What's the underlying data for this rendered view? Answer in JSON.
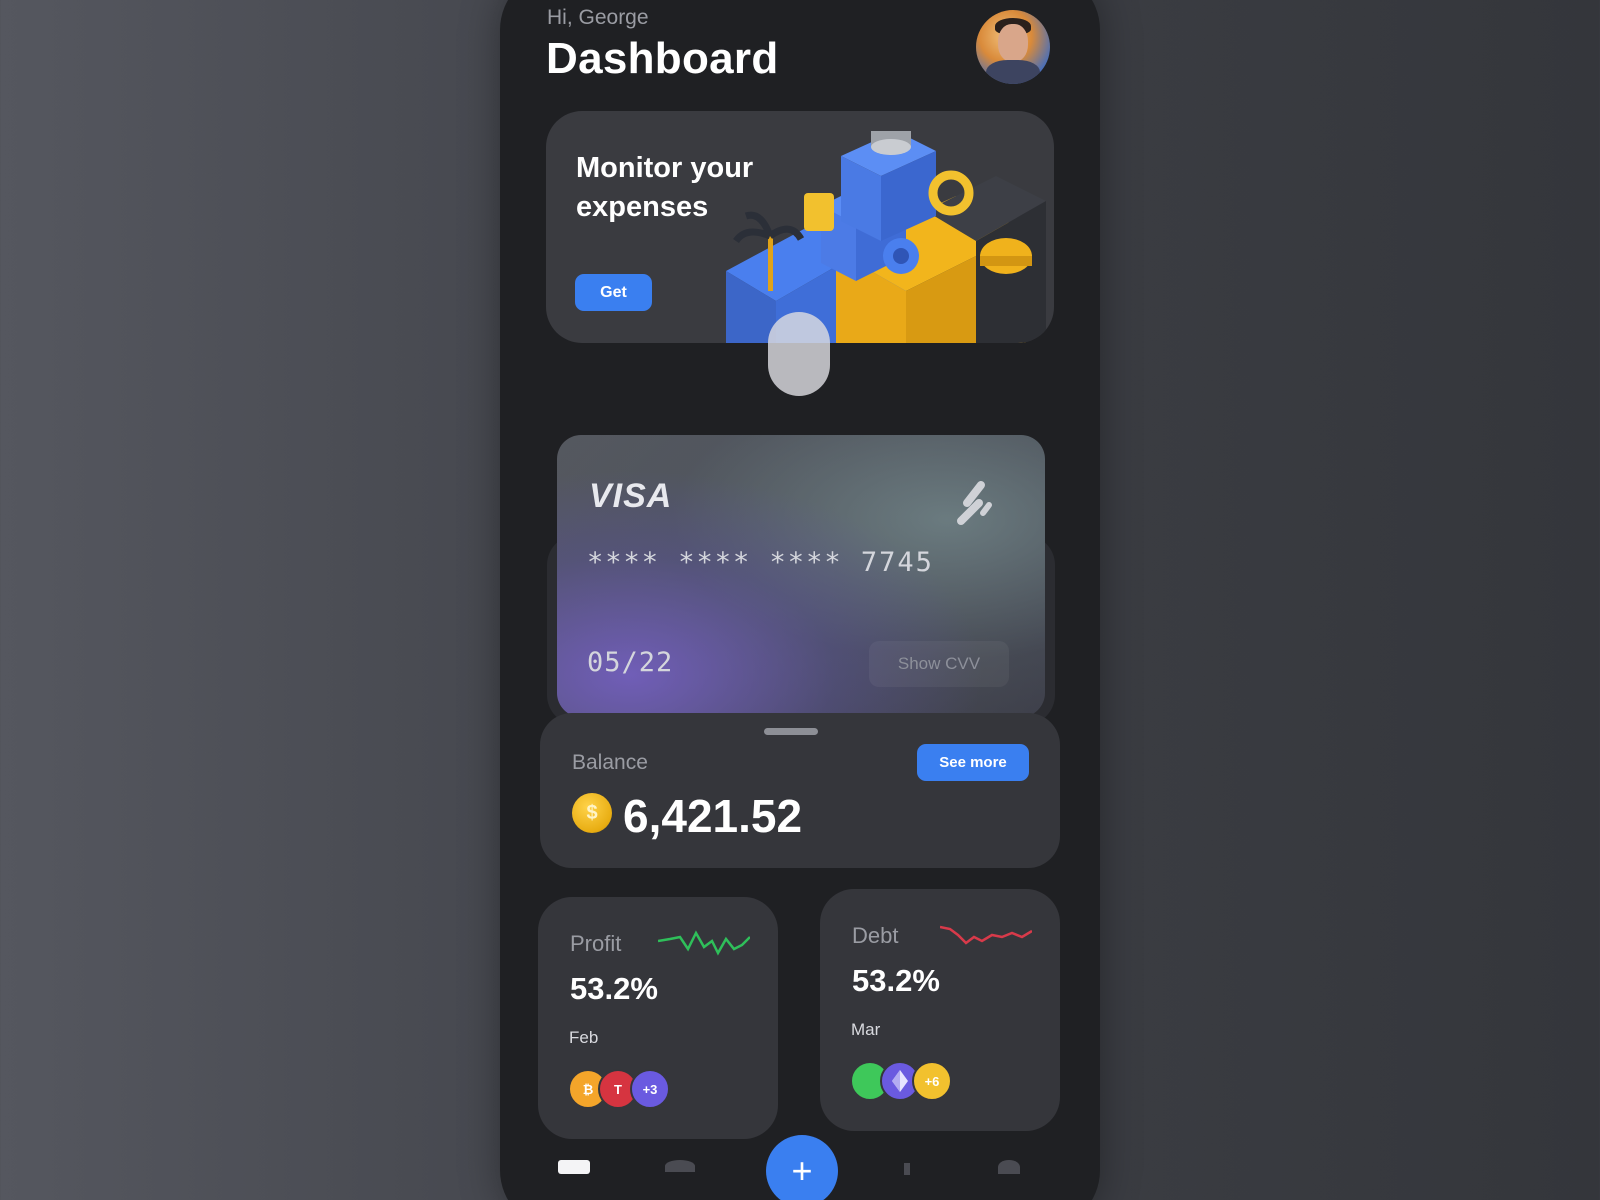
{
  "header": {
    "greeting": "Hi, George",
    "title": "Dashboard"
  },
  "promo": {
    "title": "Monitor your expenses",
    "button": "Get"
  },
  "card": {
    "brand": "VISA",
    "number": "**** **** **** 7745",
    "expiry": "05/22",
    "cvv_button": "Show CVV"
  },
  "balance": {
    "label": "Balance",
    "currency_icon": "$",
    "amount": "6,421.52",
    "see_more": "See more"
  },
  "stats": {
    "profit": {
      "label": "Profit",
      "value": "53.2%",
      "month": "Feb",
      "trend_color": "#2fbf5a",
      "tokens": [
        {
          "symbol": "₿",
          "color": "#f4a52a"
        },
        {
          "symbol": "T",
          "color": "#d63440"
        },
        {
          "symbol": "+3",
          "color": "#6a5ae0"
        }
      ]
    },
    "debt": {
      "label": "Debt",
      "value": "53.2%",
      "month": "Mar",
      "trend_color": "#d83a4a",
      "tokens": [
        {
          "symbol": "",
          "color": "#3ec85a"
        },
        {
          "symbol": "",
          "color": "#6a5ae0"
        },
        {
          "symbol": "+6",
          "color": "#f2c12e"
        }
      ]
    }
  },
  "colors": {
    "accent": "#3a7ff0",
    "background": "#1f2023",
    "surface": "#35363b"
  },
  "nav": {
    "fab_label": "+"
  }
}
